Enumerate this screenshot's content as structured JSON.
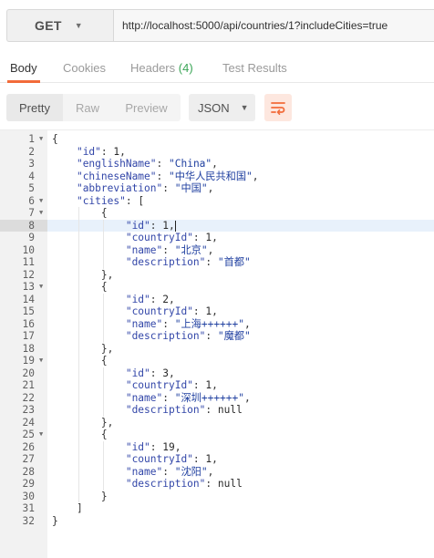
{
  "request": {
    "method": "GET",
    "url": "http://localhost:5000/api/countries/1?includeCities=true"
  },
  "response_tabs": [
    {
      "label": "Body",
      "active": true
    },
    {
      "label": "Cookies",
      "active": false
    },
    {
      "label": "Headers",
      "count": "(4)",
      "active": false
    },
    {
      "label": "Test Results",
      "active": false
    }
  ],
  "toolbar": {
    "views": [
      "Pretty",
      "Raw",
      "Preview"
    ],
    "format": "JSON",
    "wrap_icon": "wrap-lines-icon",
    "accent_color": "#f26b3a"
  },
  "code": {
    "active_line": 8,
    "foldable_lines": [
      1,
      6,
      7,
      13,
      19,
      25
    ],
    "lines": [
      "{",
      "    \"id\": 1,",
      "    \"englishName\": \"China\",",
      "    \"chineseName\": \"中华人民共和国\",",
      "    \"abbreviation\": \"中国\",",
      "    \"cities\": [",
      "        {",
      "            \"id\": 1,",
      "            \"countryId\": 1,",
      "            \"name\": \"北京\",",
      "            \"description\": \"首都\"",
      "        },",
      "        {",
      "            \"id\": 2,",
      "            \"countryId\": 1,",
      "            \"name\": \"上海++++++\",",
      "            \"description\": \"魔都\"",
      "        },",
      "        {",
      "            \"id\": 3,",
      "            \"countryId\": 1,",
      "            \"name\": \"深圳++++++\",",
      "            \"description\": null",
      "        },",
      "        {",
      "            \"id\": 19,",
      "            \"countryId\": 1,",
      "            \"name\": \"沈阳\",",
      "            \"description\": null",
      "        }",
      "    ]",
      "}"
    ]
  }
}
